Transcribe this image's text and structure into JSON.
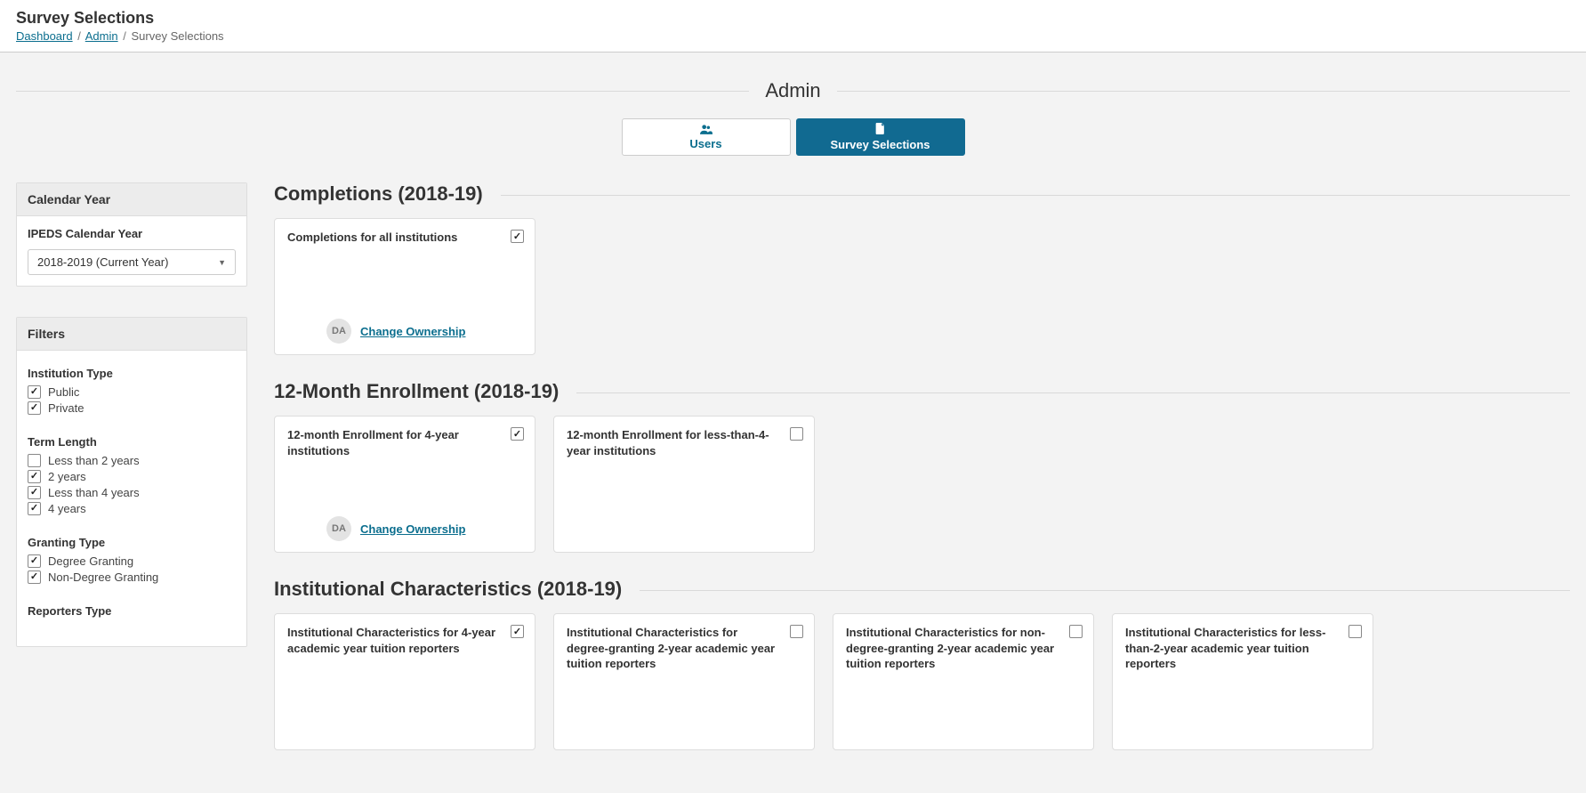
{
  "header": {
    "title": "Survey Selections",
    "breadcrumb": {
      "dashboard": "Dashboard",
      "admin": "Admin",
      "current": "Survey Selections"
    }
  },
  "section_title": "Admin",
  "tabs": {
    "users": "Users",
    "survey_selections": "Survey Selections"
  },
  "sidebar": {
    "calendar_year": {
      "panel_title": "Calendar Year",
      "field_label": "IPEDS Calendar Year",
      "selected": "2018-2019 (Current Year)"
    },
    "filters": {
      "panel_title": "Filters",
      "institution_type": {
        "label": "Institution Type",
        "options": [
          {
            "label": "Public",
            "checked": true
          },
          {
            "label": "Private",
            "checked": true
          }
        ]
      },
      "term_length": {
        "label": "Term Length",
        "options": [
          {
            "label": "Less than 2 years",
            "checked": false
          },
          {
            "label": "2 years",
            "checked": true
          },
          {
            "label": "Less than 4 years",
            "checked": true
          },
          {
            "label": "4 years",
            "checked": true
          }
        ]
      },
      "granting_type": {
        "label": "Granting Type",
        "options": [
          {
            "label": "Degree Granting",
            "checked": true
          },
          {
            "label": "Non-Degree Granting",
            "checked": true
          }
        ]
      },
      "reporters_type": {
        "label": "Reporters Type"
      }
    }
  },
  "groups": [
    {
      "title": "Completions (2018-19)",
      "cards": [
        {
          "title": "Completions for all institutions",
          "checked": true,
          "owner": "DA",
          "change_label": "Change Ownership"
        }
      ]
    },
    {
      "title": "12-Month Enrollment (2018-19)",
      "cards": [
        {
          "title": "12-month Enrollment for 4-year institutions",
          "checked": true,
          "owner": "DA",
          "change_label": "Change Ownership"
        },
        {
          "title": "12-month Enrollment for less-than-4-year institutions",
          "checked": false
        }
      ]
    },
    {
      "title": "Institutional Characteristics (2018-19)",
      "cards": [
        {
          "title": "Institutional Characteristics for 4-year academic year tuition reporters",
          "checked": true
        },
        {
          "title": "Institutional Characteristics for degree-granting 2-year academic year tuition reporters",
          "checked": false
        },
        {
          "title": "Institutional Characteristics for non-degree-granting 2-year academic year tuition reporters",
          "checked": false
        },
        {
          "title": "Institutional Characteristics for less-than-2-year academic year tuition reporters",
          "checked": false
        }
      ]
    }
  ]
}
